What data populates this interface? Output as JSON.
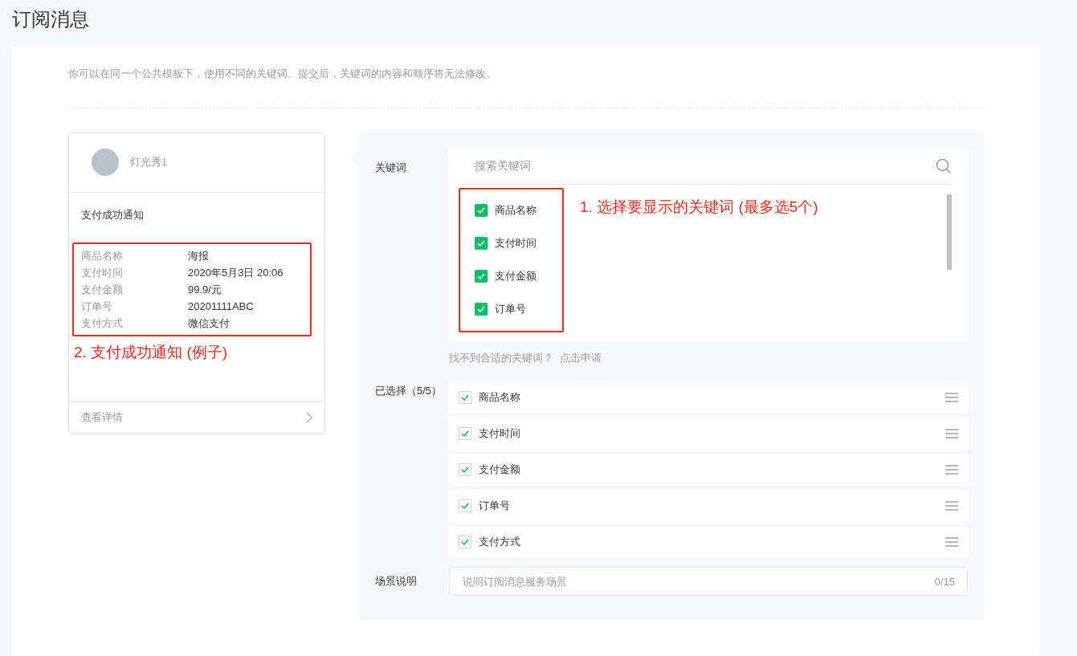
{
  "page_title": "订阅消息",
  "notice": "你可以在同一个公共模板下，使用不同的关键词。提交后，关键词的内容和顺序将无法修改。",
  "preview": {
    "account_name": "灯光秀1",
    "title": "支付成功通知",
    "fields": [
      {
        "label": "商品名称",
        "value": "海报"
      },
      {
        "label": "支付时间",
        "value": "2020年5月3日 20:06"
      },
      {
        "label": "支付金额",
        "value": "99.9/元"
      },
      {
        "label": "订单号",
        "value": "20201111ABC"
      },
      {
        "label": "支付方式",
        "value": "微信支付"
      }
    ],
    "annotation": "2. 支付成功通知 (例子)",
    "detail_link": "查看详情"
  },
  "keyword_picker": {
    "label": "关键词",
    "search": {
      "placeholder": "搜索关键词"
    },
    "options": [
      {
        "label": "商品名称",
        "checked": true
      },
      {
        "label": "支付时间",
        "checked": true
      },
      {
        "label": "支付金额",
        "checked": true
      },
      {
        "label": "订单号",
        "checked": true
      }
    ],
    "annotation": "1. 选择要显示的关键词 (最多选5个)",
    "help_text": "找不到合适的关键词？",
    "help_link": "点击申请"
  },
  "selected": {
    "label": "已选择（5/5）",
    "items": [
      {
        "label": "商品名称",
        "checked": true
      },
      {
        "label": "支付时间",
        "checked": true
      },
      {
        "label": "支付金额",
        "checked": true
      },
      {
        "label": "订单号",
        "checked": true
      },
      {
        "label": "支付方式",
        "checked": true
      }
    ]
  },
  "scene": {
    "label": "场景说明",
    "placeholder": "说明订阅消息服务场景",
    "counter": "0/15"
  }
}
